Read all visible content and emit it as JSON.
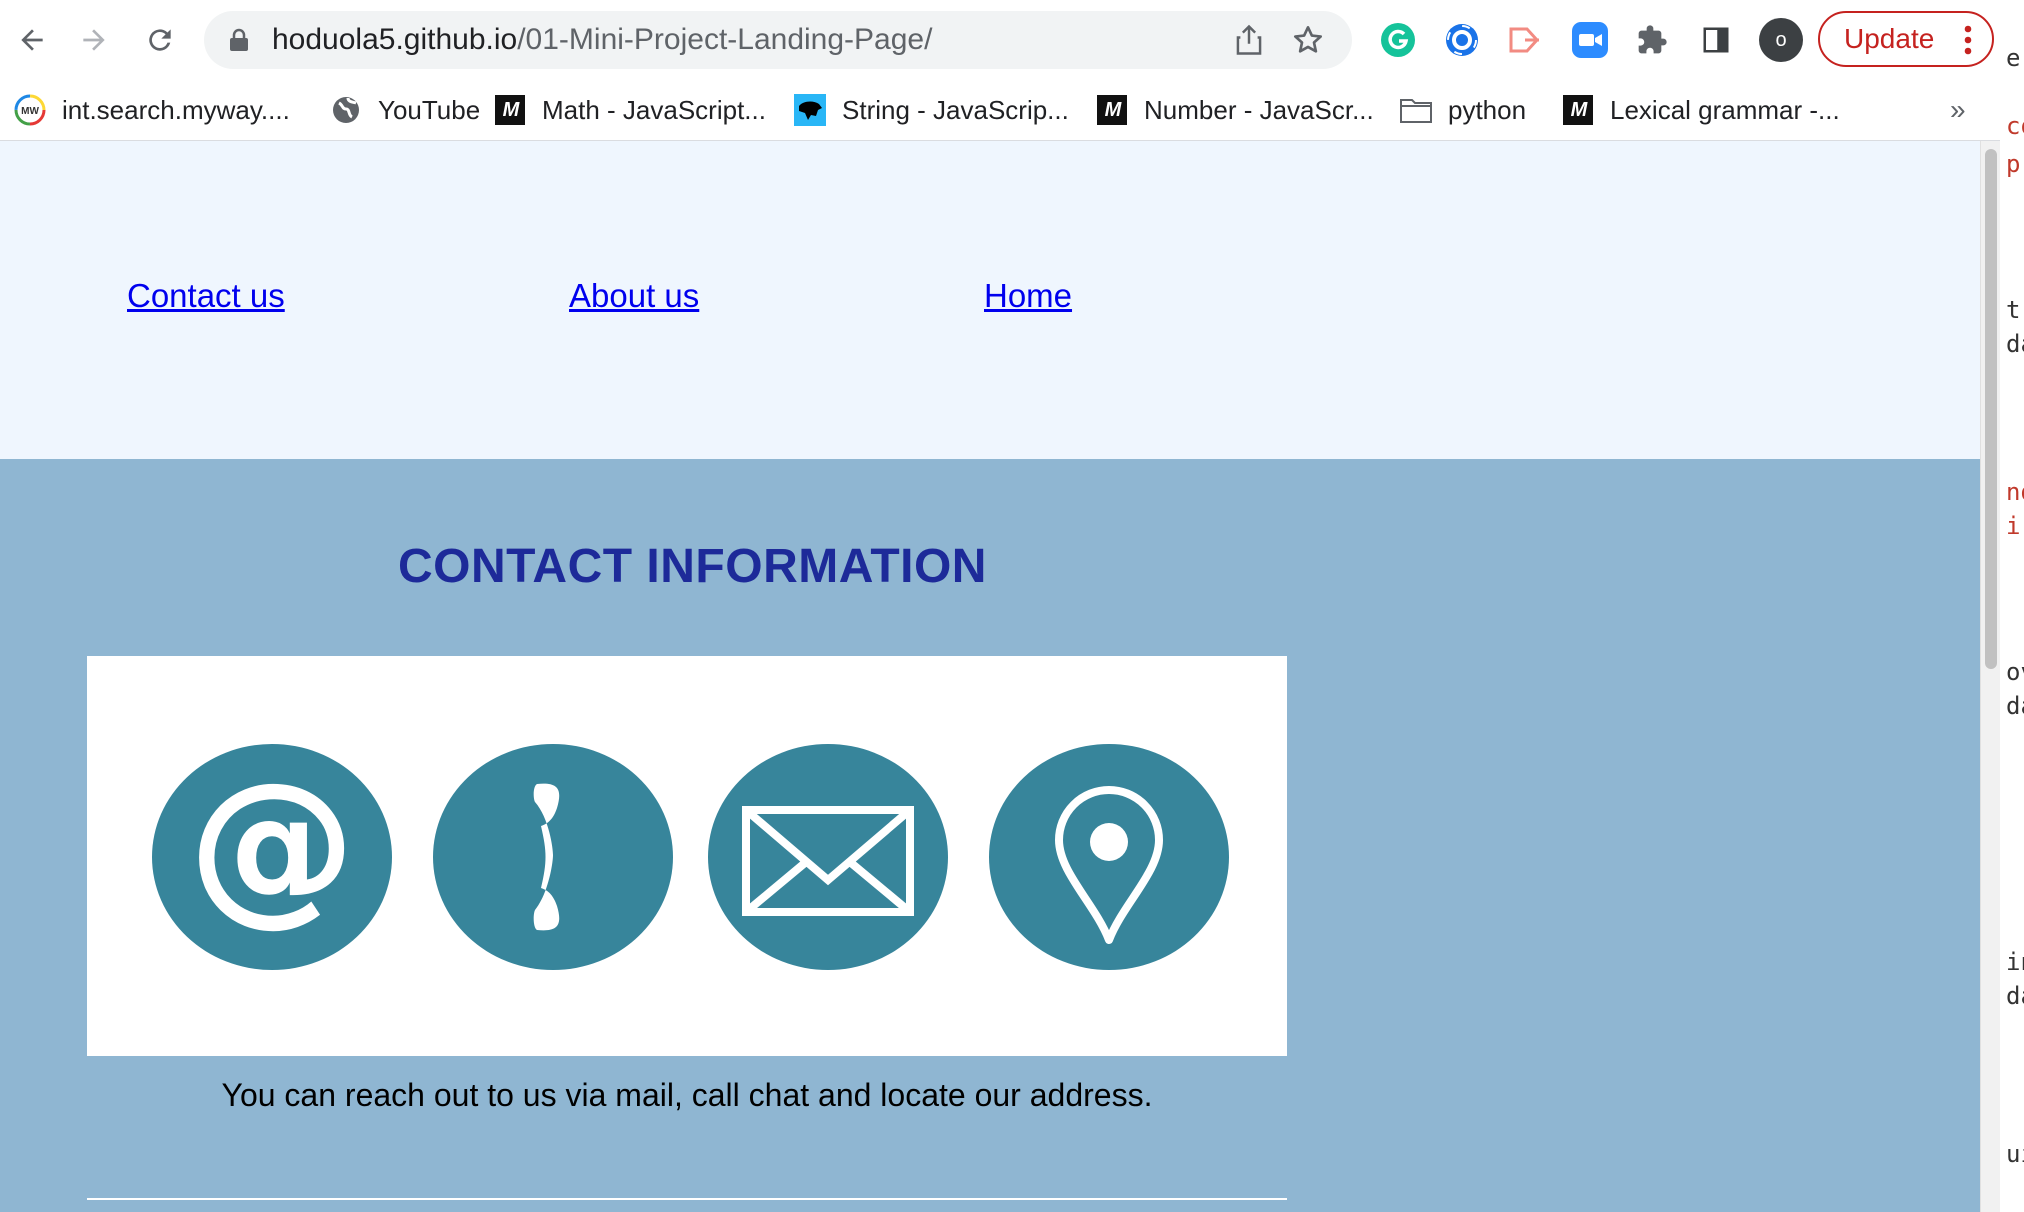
{
  "browser": {
    "url_host": "hoduola5.github.io",
    "url_path": "/01-Mini-Project-Landing-Page/",
    "profile_initial": "o",
    "update_label": "Update"
  },
  "bookmarks": [
    {
      "label": "int.search.myway....",
      "icon": "myway-icon"
    },
    {
      "label": "YouTube",
      "icon": "globe-icon"
    },
    {
      "label": "Math - JavaScript...",
      "icon": "mdn-icon"
    },
    {
      "label": "String - JavaScrip...",
      "icon": "panther-icon"
    },
    {
      "label": "Number - JavaScr...",
      "icon": "mdn-icon"
    },
    {
      "label": "python",
      "icon": "folder-icon"
    },
    {
      "label": "Lexical grammar -...",
      "icon": "mdn-icon"
    }
  ],
  "bookmarks_more": "»",
  "nav": {
    "links": [
      "Contact us",
      "About us",
      "Home"
    ]
  },
  "contact": {
    "title": "CONTACT INFORMATION",
    "icons": [
      "at-sign-icon",
      "phone-icon",
      "envelope-icon",
      "location-pin-icon"
    ],
    "text": "You can reach out to us via mail, call chat and locate our address."
  },
  "side_peek": [
    "e",
    "co",
    "p'",
    "t:",
    "da",
    "nd",
    "i-",
    "ov",
    "da",
    "in",
    "da",
    "ui"
  ],
  "colors": {
    "nav_bg": "#eff6fe",
    "contact_bg": "#8fb6d2",
    "title": "#1d2a99",
    "icon_circle": "#37859b",
    "link": "#0000ee",
    "update_red": "#c5221f"
  }
}
